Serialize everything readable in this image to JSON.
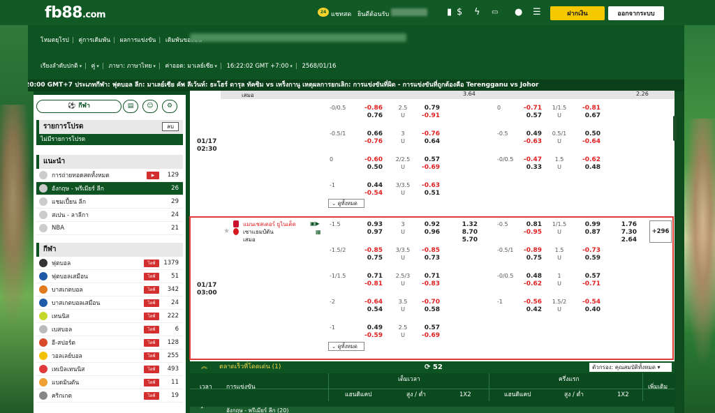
{
  "header": {
    "logo_main": "fb88",
    "logo_suffix": ".com",
    "chat_badge": "24",
    "chat_label": "แชทสด",
    "welcome_label": "ยินดีต้อนรับ",
    "deposit_label": "ฝากเงิน",
    "logout_label": "ออกจากระบบ"
  },
  "nav": {
    "items": [
      "โหมดยุโรป",
      "คู่การเดิมพัน",
      "ผลการแข่งขัน",
      "เดิมพันของฉัน"
    ],
    "sort_label": "เรียงลำดับปกติ",
    "pair_label": "คู่",
    "language_label": "ภาษา: ภาษาไทย",
    "currency_label": "ค่าออด: มาเลย์เซีย",
    "time_label": "16:22:02 GMT +7:00",
    "date_label": "2568/01/16"
  },
  "ticker": "20:00 GMT+7 ประเภทกีฬา: ฟุตบอล ลีก: มาเลย์เซีย คัพ ลีเว้นท์: ธะโฮร์ ดารุล ทัคซิม vs เทร็งกานู เหตุผลการยกเลิก: การแข่งขันที่ผิด - การแข่งขันที่ถูกต้องคือ Terengganu vs Johor",
  "left_panel": {
    "sport_tab": "กีฬา",
    "favorites": {
      "title": "รายการโปรด",
      "delete_label": "ลบ",
      "empty": "ไม่มีรายการโปรด"
    },
    "recommended": {
      "title": "แนะนำ",
      "items": [
        {
          "name": "การถ่ายทอดสดทั้งหมด",
          "count": "129",
          "live": true,
          "active": false
        },
        {
          "name": "อังกฤษ - พรีเมียร์ ลีก",
          "count": "26",
          "live": false,
          "active": true
        },
        {
          "name": "แชมเปี้ยน ลีก",
          "count": "29",
          "live": false,
          "active": false
        },
        {
          "name": "สเปน - ลาลีกา",
          "count": "24",
          "live": false,
          "active": false
        },
        {
          "name": "NBA",
          "count": "21",
          "live": false,
          "active": false
        }
      ]
    },
    "sports": {
      "title": "กีฬา",
      "live_label": "ไลฟ์",
      "items": [
        {
          "name": "ฟุตบอล",
          "count": "1379"
        },
        {
          "name": "ฟุตบอลเสมือน",
          "count": "51"
        },
        {
          "name": "บาสเกตบอล",
          "count": "342"
        },
        {
          "name": "บาสเกตบอลเสมือน",
          "count": "24"
        },
        {
          "name": "เทนนิส",
          "count": "222"
        },
        {
          "name": "เบสบอล",
          "count": "6"
        },
        {
          "name": "อี-สปอร์ต",
          "count": "128"
        },
        {
          "name": "วอลเลย์บอล",
          "count": "255"
        },
        {
          "name": "เทเบิลเทนนิส",
          "count": "493"
        },
        {
          "name": "แบดมินตัน",
          "count": "11"
        },
        {
          "name": "คริกเกต",
          "count": "19"
        }
      ]
    }
  },
  "main": {
    "prev_row": {
      "label": "เสมอ",
      "odd1": "3.64",
      "odd2": "2.26"
    },
    "match1": {
      "time": "01/17\n02:30",
      "more_label": "ดูทั้งหมด",
      "rows": [
        {
          "h1": "-0/0.5",
          "o1a": "-0.86",
          "o1b": "0.76",
          "ou1": "2.5",
          "u1": "U",
          "o2a": "0.79",
          "o2b": "-0.91",
          "h2": "0",
          "o3a": "-0.71",
          "o3b": "0.57",
          "ou2": "1/1.5",
          "u2": "U",
          "o4a": "-0.81",
          "o4b": "0.67"
        },
        {
          "h1": "-0.5/1",
          "o1a": "0.66",
          "o1b": "-0.76",
          "ou1": "3",
          "u1": "U",
          "o2a": "-0.76",
          "o2b": "0.64",
          "h2": "-0.5",
          "o3a": "0.49",
          "o3b": "-0.63",
          "ou2": "0.5/1",
          "u2": "U",
          "o4a": "0.50",
          "o4b": "-0.64"
        },
        {
          "h1": "0",
          "o1a": "-0.60",
          "o1b": "0.50",
          "ou1": "2/2.5",
          "u1": "U",
          "o2a": "0.57",
          "o2b": "-0.69",
          "h2": "-0/0.5",
          "o3a": "-0.47",
          "o3b": "0.33",
          "ou2": "1.5",
          "u2": "U",
          "o4a": "-0.62",
          "o4b": "0.48"
        },
        {
          "h1": "-1",
          "o1a": "0.44",
          "o1b": "-0.54",
          "ou1": "3/3.5",
          "u1": "U",
          "o2a": "-0.63",
          "o2b": "0.51",
          "h2": "",
          "o3a": "",
          "o3b": "",
          "ou2": "",
          "u2": "",
          "o4a": "",
          "o4b": ""
        }
      ]
    },
    "match2": {
      "time": "01/17\n03:00",
      "home": "แมนเชสเตอร์ ยูไนเต็ด",
      "away": "เซาแธมป์ตัน",
      "draw": "เสมอ",
      "plus_label": "+296",
      "more_label": "ดูทั้งหมด",
      "x12_full": [
        "1.32",
        "8.70",
        "5.70"
      ],
      "x12_half": [
        "1.76",
        "7.30",
        "2.64"
      ],
      "rows": [
        {
          "h1": "-1.5",
          "o1a": "0.93",
          "o1b": "0.97",
          "ou1": "3",
          "u1": "U",
          "o2a": "0.92",
          "o2b": "0.96",
          "h2": "-0.5",
          "o3a": "0.81",
          "o3b": "-0.95",
          "ou2": "1/1.5",
          "u2": "U",
          "o4a": "0.99",
          "o4b": "0.87"
        },
        {
          "h1": "-1.5/2",
          "o1a": "-0.85",
          "o1b": "0.75",
          "ou1": "3/3.5",
          "u1": "U",
          "o2a": "-0.85",
          "o2b": "0.73",
          "h2": "-0.5/1",
          "o3a": "-0.89",
          "o3b": "0.75",
          "ou2": "1.5",
          "u2": "U",
          "o4a": "-0.73",
          "o4b": "0.59"
        },
        {
          "h1": "-1/1.5",
          "o1a": "0.71",
          "o1b": "-0.81",
          "ou1": "2.5/3",
          "u1": "U",
          "o2a": "0.71",
          "o2b": "-0.83",
          "h2": "-0/0.5",
          "o3a": "0.48",
          "o3b": "-0.62",
          "ou2": "1",
          "u2": "U",
          "o4a": "0.57",
          "o4b": "-0.71"
        },
        {
          "h1": "-2",
          "o1a": "-0.64",
          "o1b": "0.54",
          "ou1": "3.5",
          "u1": "U",
          "o2a": "-0.70",
          "o2b": "0.58",
          "h2": "-1",
          "o3a": "-0.56",
          "o3b": "0.42",
          "ou2": "1.5/2",
          "u2": "U",
          "o4a": "-0.54",
          "o4b": "0.40"
        },
        {
          "h1": "-1",
          "o1a": "0.49",
          "o1b": "-0.59",
          "ou1": "2.5",
          "u1": "U",
          "o2a": "0.57",
          "o2b": "-0.69",
          "h2": "",
          "o3a": "",
          "o3b": "",
          "ou2": "",
          "u2": "",
          "o4a": "",
          "o4b": ""
        }
      ]
    }
  },
  "bottom": {
    "section_title": "ตลาดเร็วที่โดดเด่น (1)",
    "refresh_count": "52",
    "filter_label": "ตัวกรอง: คุณสมบัติทั้งหมด",
    "col_time": "เวลา",
    "col_event": "การแข่งขัน",
    "col_full": "เต็มเวลา",
    "col_half": "ครึ่งแรก",
    "col_more": "เพิ่มเติม",
    "sub_cols": [
      "แฮนดิแคป",
      "สูง / ต่ำ",
      "1X2",
      "แฮนดิแคป",
      "สูง / ต่ำ",
      "1X2"
    ],
    "league_row": "อังกฤษ - พรีเมียร์ ลีก (20)"
  },
  "colors": {
    "brand_green": "#0e5423",
    "accent_yellow": "#f6c800",
    "negative_red": "#e02020",
    "highlight_red": "#e03a3a"
  }
}
